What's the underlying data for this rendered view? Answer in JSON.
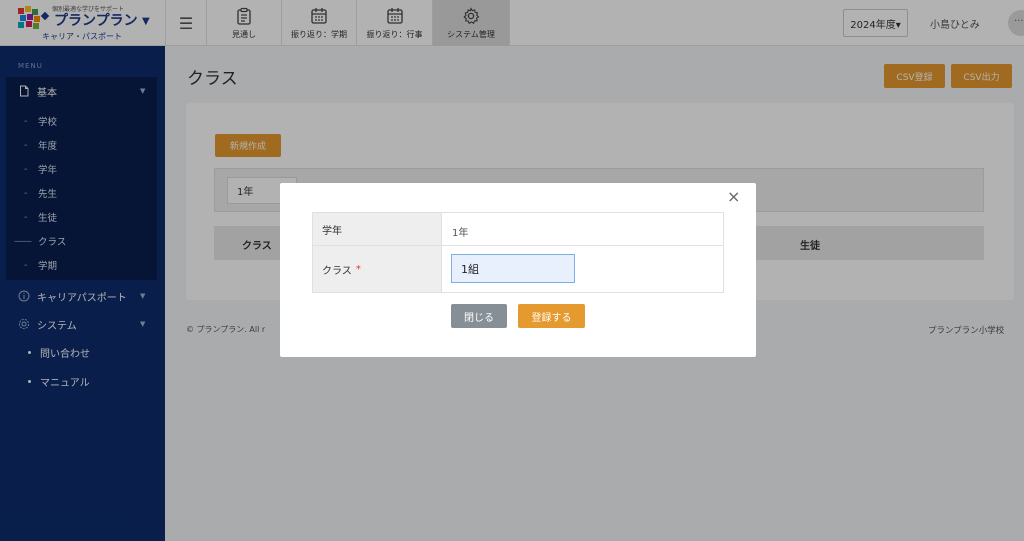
{
  "header": {
    "logo": {
      "tagline": "個別最適な学びをサポート",
      "name": "プランプラン",
      "subtitle": "キャリア・パスポート"
    },
    "menu_icon": "hamburger-icon",
    "tabs": [
      {
        "label": "見通し",
        "icon": "clipboard-icon"
      },
      {
        "label": "振り返り：学期",
        "icon": "calendar-icon"
      },
      {
        "label": "振り返り：行事",
        "icon": "calendar-icon"
      },
      {
        "label": "システム管理",
        "icon": "gear-icon",
        "active": true
      }
    ],
    "year_select": "2024年度▾",
    "user_name": "小島ひとみ",
    "more": "···"
  },
  "sidebar": {
    "menu_label": "MENU",
    "basic": {
      "label": "基本",
      "children": [
        {
          "label": "学校",
          "active": false
        },
        {
          "label": "年度",
          "active": false
        },
        {
          "label": "学年",
          "active": false
        },
        {
          "label": "先生",
          "active": false
        },
        {
          "label": "生徒",
          "active": false
        },
        {
          "label": "クラス",
          "active": true
        },
        {
          "label": "学期",
          "active": false
        }
      ]
    },
    "career": {
      "label": "キャリアパスポート"
    },
    "system": {
      "label": "システム"
    },
    "links": [
      {
        "label": "問い合わせ"
      },
      {
        "label": "マニュアル"
      }
    ]
  },
  "main": {
    "title": "クラス",
    "csv_import": "CSV登録",
    "csv_export": "CSV出力",
    "new_button": "新規作成",
    "grade_select": "1年",
    "table_headers": [
      "クラス",
      "生徒"
    ],
    "footer_copyright": "© プランプラン. All r",
    "footer_school": "プランプラン小学校"
  },
  "modal": {
    "close_glyph": "×",
    "fields": [
      {
        "label": "学年",
        "value": "1年"
      },
      {
        "label": "クラス",
        "required_mark": "*",
        "value": "1組"
      }
    ],
    "close_button": "閉じる",
    "submit_button": "登録する"
  },
  "colors": {
    "sidebar": "#0d2c6b",
    "accent": "#e59a2f",
    "brand": "#1f3b8c"
  }
}
